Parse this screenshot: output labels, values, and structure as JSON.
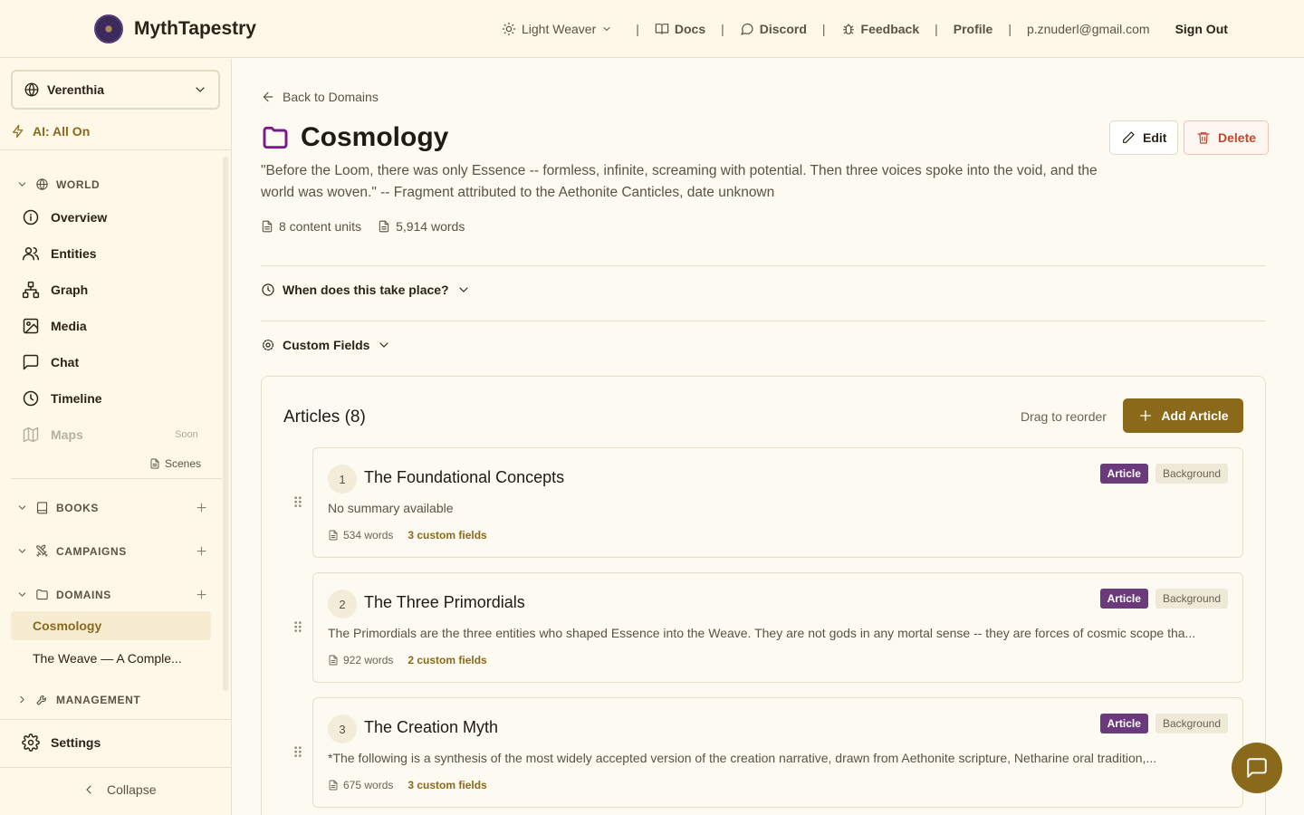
{
  "header": {
    "brand": "MythTapestry",
    "theme": "Light Weaver",
    "docs": "Docs",
    "discord": "Discord",
    "feedback": "Feedback",
    "profile": "Profile",
    "separator": "|",
    "email": "p.znuderl@gmail.com",
    "sign_out": "Sign Out"
  },
  "sidebar": {
    "world_select": "Verenthia",
    "ai_status": "AI: All On",
    "world_section": "WORLD",
    "items": [
      {
        "label": "Overview"
      },
      {
        "label": "Entities"
      },
      {
        "label": "Graph"
      },
      {
        "label": "Media"
      },
      {
        "label": "Chat"
      },
      {
        "label": "Timeline"
      },
      {
        "label": "Maps"
      }
    ],
    "soon": "Soon",
    "scenes": "Scenes",
    "books_section": "BOOKS",
    "campaigns_section": "CAMPAIGNS",
    "domains_section": "DOMAINS",
    "domains": [
      "Cosmology",
      "The Weave — A Comple..."
    ],
    "management_section": "MANAGEMENT",
    "settings": "Settings",
    "collapse": "Collapse"
  },
  "main": {
    "back": "Back to Domains",
    "title": "Cosmology",
    "edit": "Edit",
    "delete": "Delete",
    "description": "\"Before the Loom, there was only Essence -- formless, infinite, screaming with potential. Then three voices spoke into the void, and the world was woven.\" -- Fragment attributed to the Aethonite Canticles, date unknown",
    "content_units": "8 content units",
    "words": "5,914 words",
    "when_label": "When does this take place?",
    "custom_fields_label": "Custom Fields",
    "articles_title": "Articles (8)",
    "drag_hint": "Drag to reorder",
    "add_article": "Add Article",
    "badge_article": "Article",
    "badge_background": "Background",
    "cards": [
      {
        "num": "1",
        "title": "The Foundational Concepts",
        "summary": "No summary available",
        "words": "534 words",
        "fields": "3 custom fields"
      },
      {
        "num": "2",
        "title": "The Three Primordials",
        "summary": "The Primordials are the three entities who shaped Essence into the Weave. They are not gods in any mortal sense -- they are forces of cosmic scope tha...",
        "words": "922 words",
        "fields": "2 custom fields"
      },
      {
        "num": "3",
        "title": "The Creation Myth",
        "summary": "*The following is a synthesis of the most widely accepted version of the creation narrative, drawn from Aethonite scripture, Netharine oral tradition,...",
        "words": "675 words",
        "fields": "3 custom fields"
      }
    ]
  },
  "colors": {
    "accent": "#8a6a1a",
    "badge_article": "#6a3a7a",
    "delete": "#c0482e",
    "folder": "#7a1a8a"
  }
}
